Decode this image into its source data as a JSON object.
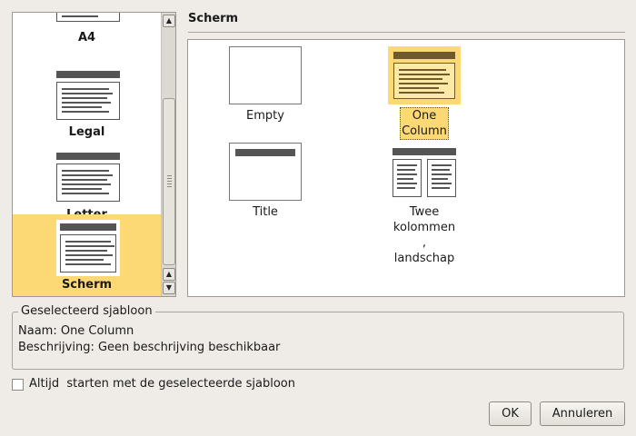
{
  "categories": [
    {
      "label": "A4",
      "selected": false
    },
    {
      "label": "Legal",
      "selected": false
    },
    {
      "label": "Letter",
      "selected": false
    },
    {
      "label": "Scherm",
      "selected": true
    }
  ],
  "section_title": "Scherm",
  "templates": [
    {
      "label": "Empty",
      "selected": false
    },
    {
      "label": "One Column",
      "selected": true
    },
    {
      "label": "Title",
      "selected": false
    },
    {
      "label": "Twee kolommen , landschap",
      "selected": false
    }
  ],
  "info": {
    "legend": "Geselecteerd sjabloon",
    "name_line": "Naam: One Column",
    "desc_line": "Beschrijving: Geen beschrijving beschikbaar"
  },
  "checkbox": {
    "label": "Altijd  starten met de geselecteerde sjabloon",
    "checked": false
  },
  "buttons": {
    "ok": "OK",
    "cancel": "Annuleren"
  },
  "colors": {
    "selection": "#fcd975",
    "background": "#efebe7"
  },
  "icons": {
    "scroll_up": "triangle-up",
    "scroll_down": "triangle-down"
  }
}
